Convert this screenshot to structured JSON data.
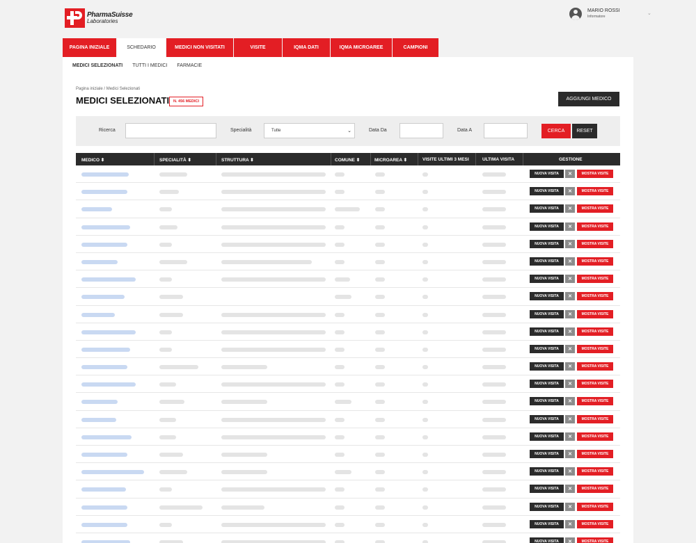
{
  "brand": {
    "name": "PharmaSuisse",
    "sub": "Laboratories",
    "color": "#e31e24"
  },
  "user": {
    "name": "MARIO ROSSI",
    "role": "Informatore"
  },
  "mainnav": [
    {
      "label": "PAGINA INIZIALE",
      "active": false
    },
    {
      "label": "SCHEDARIO",
      "active": true
    },
    {
      "label": "MEDICI NON VISITATI",
      "active": false
    },
    {
      "label": "VISITE",
      "active": false
    },
    {
      "label": "IQMA DATI",
      "active": false
    },
    {
      "label": "IQMA MICROAREE",
      "active": false
    },
    {
      "label": "CAMPIONI",
      "active": false
    }
  ],
  "subnav": [
    {
      "label": "MEDICI SELEZIONATI",
      "active": true
    },
    {
      "label": "TUTTI I MEDICI",
      "active": false
    },
    {
      "label": "FARMACIE",
      "active": false
    }
  ],
  "breadcrumb": "Pagina iniziale  /  Medici Selezionati",
  "page_title": "MEDICI SELEZIONATI",
  "count_badge": "N. 456 MEDICI",
  "add_button": "AGGIUNGI MEDICO",
  "filter": {
    "search_label": "Ricerca",
    "specialty_label": "Specialità",
    "specialty_value": "Tutte",
    "date_from_label": "Data Da",
    "date_to_label": "Data A",
    "search_button": "CERCA",
    "reset_button": "RESET"
  },
  "table": {
    "headers": [
      "MEDICO ⬍",
      "SPECIALITÀ ⬍",
      "STRUTTURA ⬍",
      "COMUNE ⬍",
      "MICROAREA ⬍",
      "VISITE ULTIMI 3 MESI",
      "ULTIMA VISITA",
      "GESTIONE"
    ],
    "actions": {
      "new_visit": "NUOVA VISITA",
      "remove": "✕",
      "show_visits": "MOSTRA VISITE"
    },
    "row_count": 22,
    "row_has_struttura": [
      true,
      true,
      true,
      true,
      true,
      true,
      true,
      false,
      true,
      true,
      true,
      true,
      true,
      true,
      true,
      true,
      true,
      true,
      true,
      true,
      true,
      true
    ]
  }
}
